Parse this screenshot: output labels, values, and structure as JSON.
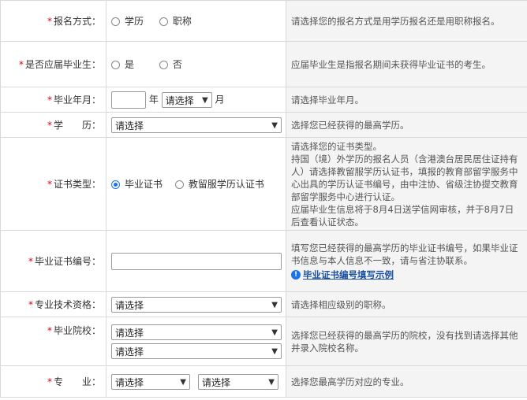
{
  "rows": {
    "apply_method": {
      "label": "报名方式：",
      "options": [
        "学历",
        "职称"
      ],
      "tip": "请选择您的报名方式是用学历报名还是用职称报名。"
    },
    "fresh_grad": {
      "label": "是否应届毕业生：",
      "options": [
        "是",
        "否"
      ],
      "tip": "应届毕业生是指报名期间未获得毕业证书的考生。"
    },
    "grad_date": {
      "label": "毕业年月：",
      "year_unit": "年",
      "month_select": "请选择",
      "month_unit": "月",
      "tip": "请选择毕业年月。"
    },
    "education": {
      "label": "学　　历：",
      "select": "请选择",
      "tip": "选择您已经获得的最高学历。"
    },
    "cert_type": {
      "label": "证书类型：",
      "options": [
        "毕业证书",
        "教留服学历认证书"
      ],
      "selected": 0,
      "tip_lines": [
        "请选择您的证书类型。",
        "持国（境）外学历的报名人员（含港澳台居民居住证持有人）请选择教留服学历认证书，填报的教育部留学服务中心出具的学历认证书编号，由中注协、省级注协提交教育部留学服务中心进行认证。",
        "应届毕业生信息将于8月4日送学信网审核，并于8月7日后查看认证状态。"
      ]
    },
    "cert_no": {
      "label": "毕业证书编号：",
      "tip": "填写您已经获得的最高学历的毕业证书编号，如果毕业证书信息与本人信息不一致，请与省注协联系。",
      "link": "毕业证书编号填写示例"
    },
    "title": {
      "label": "专业技术资格：",
      "select": "请选择",
      "tip": "请选择相应级别的职称。"
    },
    "school": {
      "label": "毕业院校：",
      "select1": "请选择",
      "select2": "请选择",
      "tip": "选择您已经获得的最高学历的院校，没有找到请选择其他并录入院校名称。"
    },
    "major": {
      "label": "专　　业：",
      "select1": "请选择",
      "select2": "请选择",
      "tip": "选择您最高学历对应的专业。"
    }
  },
  "required_mark": "*",
  "dropdown_arrow": "chevron-down-icon",
  "accent_color": "#1a73e8",
  "required_color": "#d9000b"
}
